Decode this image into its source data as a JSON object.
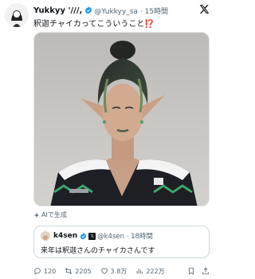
{
  "tweet": {
    "display_name": "Yukkyy '///,",
    "handle_time": "@Yukkyy_sa · 15時間",
    "text": "釈迦チャイカってこういうこと",
    "text_emoji": "⁉️"
  },
  "ai_label": "AIで生成",
  "quote": {
    "display_name": "k4sen",
    "badge_x": "𝕏",
    "handle_time": "@k4sen · 18時間",
    "text": "来年は釈迦さんのチャイカさんです"
  },
  "actions": {
    "replies": "120",
    "retweets": "2205",
    "likes": "3.8万",
    "views": "222万"
  },
  "colors": {
    "verified": "#1d9bf0",
    "text": "#0f1419",
    "secondary": "#536471",
    "alert": "#f4212e"
  }
}
